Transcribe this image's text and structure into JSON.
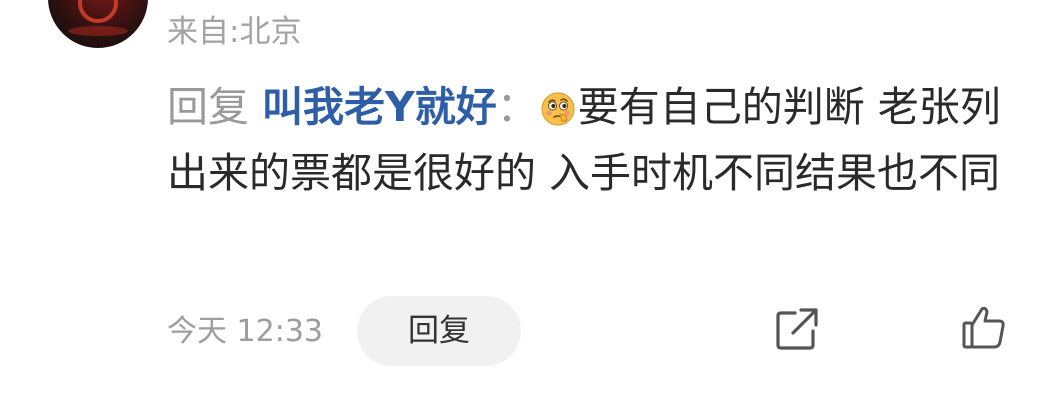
{
  "header": {
    "location": "来自:北京",
    "avatar_icon": "user-avatar"
  },
  "comment": {
    "reply_word": "回复",
    "mention": "叫我老Y就好",
    "colon": "：",
    "emoji": "thinking-face-emoji",
    "body": "要有自己的判断 老张列出来的票都是很好的 入手时机不同结果也不同"
  },
  "footer": {
    "time": "今天 12:33",
    "reply_button": "回复",
    "share_icon": "share-icon",
    "like_icon": "thumbs-up-icon"
  },
  "colors": {
    "mention": "#2f5ea8",
    "meta_text": "#a3a3a3",
    "body_text": "#2a2a2a",
    "button_bg": "#f1f1f1"
  }
}
